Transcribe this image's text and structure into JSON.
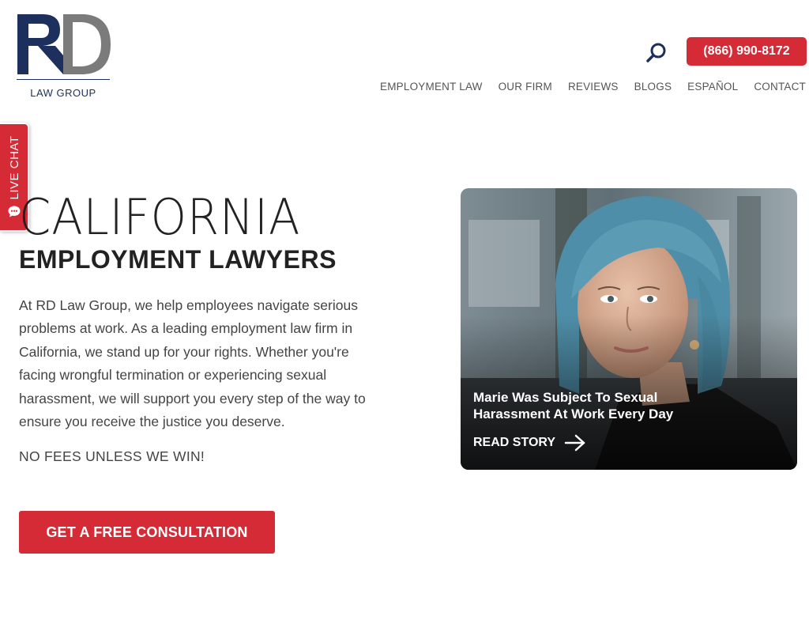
{
  "logo": {
    "mark": "RD",
    "subtitle": "LAW GROUP",
    "brand_navy": "#1d2f5c"
  },
  "header": {
    "search_icon": "search-icon",
    "phone": "(866) 990-8172",
    "nav": [
      "EMPLOYMENT LAW",
      "OUR FIRM",
      "REVIEWS",
      "BLOGS",
      "ESPAÑOL",
      "CONTACT"
    ]
  },
  "live_chat": {
    "label": "LIVE CHAT",
    "icon": "chat-bubble-icon"
  },
  "hero": {
    "title_line1": "CALIFORNIA",
    "title_line2": "EMPLOYMENT LAWYERS",
    "paragraph_lines": [
      "At RD Law Group, we help employees navigate serious",
      "problems at work. As a leading employment law firm in",
      "California, we stand up for your rights. Whether you're",
      "facing wrongful termination or experiencing sexual",
      "harassment, we will support you every step of the way to",
      "ensure you receive the justice you deserve."
    ],
    "tagline": "NO FEES UNLESS WE WIN!",
    "cta": "GET A FREE CONSULTATION"
  },
  "story_card": {
    "title_lines": [
      "Marie Was Subject To Sexual",
      "Harassment At Work Every Day"
    ],
    "link": "READ STORY",
    "link_icon": "arrow-right-icon"
  },
  "colors": {
    "accent_red": "#d52b36",
    "text_dark": "#222222",
    "text_body": "#444444"
  }
}
